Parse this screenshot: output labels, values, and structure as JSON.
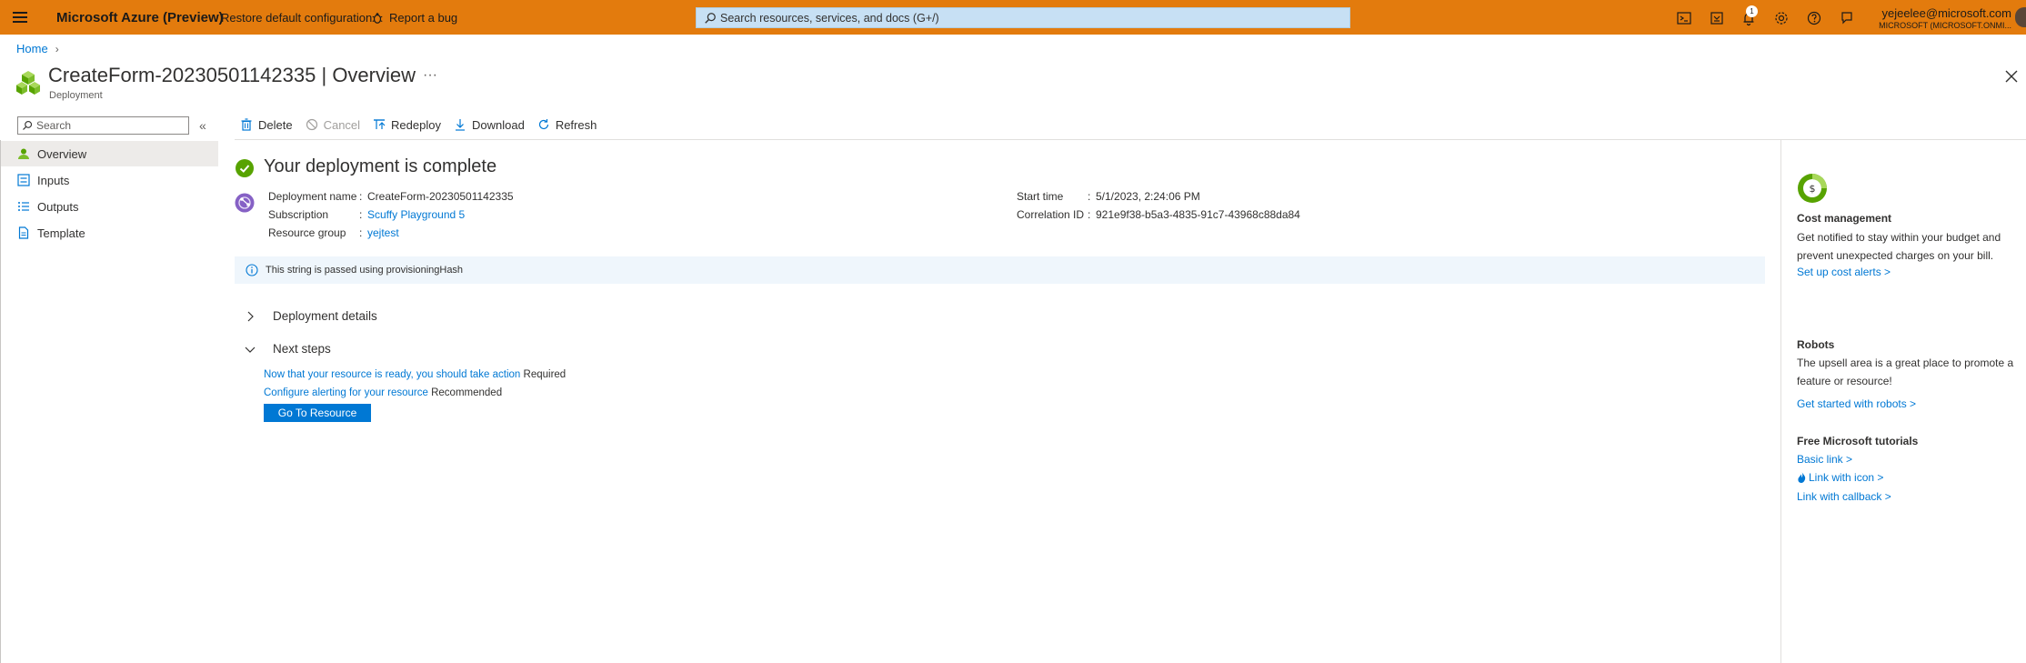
{
  "topbar": {
    "brand": "Microsoft Azure (Preview)",
    "restore_label": "Restore default configuration",
    "bug_label": "Report a bug",
    "search_placeholder": "Search resources, services, and docs (G+/)",
    "notification_count": "1",
    "user_email": "yejeelee@microsoft.com",
    "user_tenant": "MICROSOFT (MICROSOFT.ONMI..."
  },
  "breadcrumb": {
    "home": "Home"
  },
  "header": {
    "title": "CreateForm-20230501142335",
    "separator": " | ",
    "section": "Overview",
    "more": "···",
    "subtitle": "Deployment"
  },
  "nav": {
    "search_placeholder": "Search",
    "collapse": "«",
    "items": [
      {
        "label": "Overview",
        "icon": "overview-icon"
      },
      {
        "label": "Inputs",
        "icon": "inputs-icon"
      },
      {
        "label": "Outputs",
        "icon": "outputs-icon"
      },
      {
        "label": "Template",
        "icon": "template-icon"
      }
    ]
  },
  "toolbar": {
    "delete": "Delete",
    "cancel": "Cancel",
    "redeploy": "Redeploy",
    "download": "Download",
    "refresh": "Refresh"
  },
  "deployment": {
    "heading": "Your deployment is complete",
    "name_label": "Deployment name",
    "name_value": "CreateForm-20230501142335",
    "subscription_label": "Subscription",
    "subscription_value": "Scuffy Playground 5",
    "rg_label": "Resource group",
    "rg_value": "yejtest",
    "start_label": "Start time",
    "start_value": "5/1/2023, 2:24:06 PM",
    "corr_label": "Correlation ID",
    "corr_value": "921e9f38-b5a3-4835-91c7-43968c88da84",
    "colon": ":"
  },
  "info": {
    "text": "This string is passed using provisioningHash"
  },
  "sections": {
    "details": "Deployment details",
    "next": "Next steps"
  },
  "next_steps": {
    "step1_link": "Now that your resource is ready, you should take action",
    "step1_tag": "Required",
    "step2_link": "Configure alerting for your resource",
    "step2_tag": "Recommended",
    "go_button": "Go To Resource"
  },
  "right_panel": {
    "cost_title": "Cost management",
    "cost_text": "Get notified to stay within your budget and prevent unexpected charges on your bill.",
    "cost_link": "Set up cost alerts >",
    "robots_title": "Robots",
    "robots_text": "The upsell area is a great place to promote a feature or resource!",
    "robots_link": "Get started with robots >",
    "tutorials_title": "Free Microsoft tutorials",
    "basic_link": "Basic link >",
    "icon_link": "Link with icon >",
    "callback_link": "Link with callback >"
  },
  "colors": {
    "topbar": "#e37b0d",
    "accent": "#0078d4",
    "success": "#57a300",
    "info_bg": "#eff6fc"
  }
}
